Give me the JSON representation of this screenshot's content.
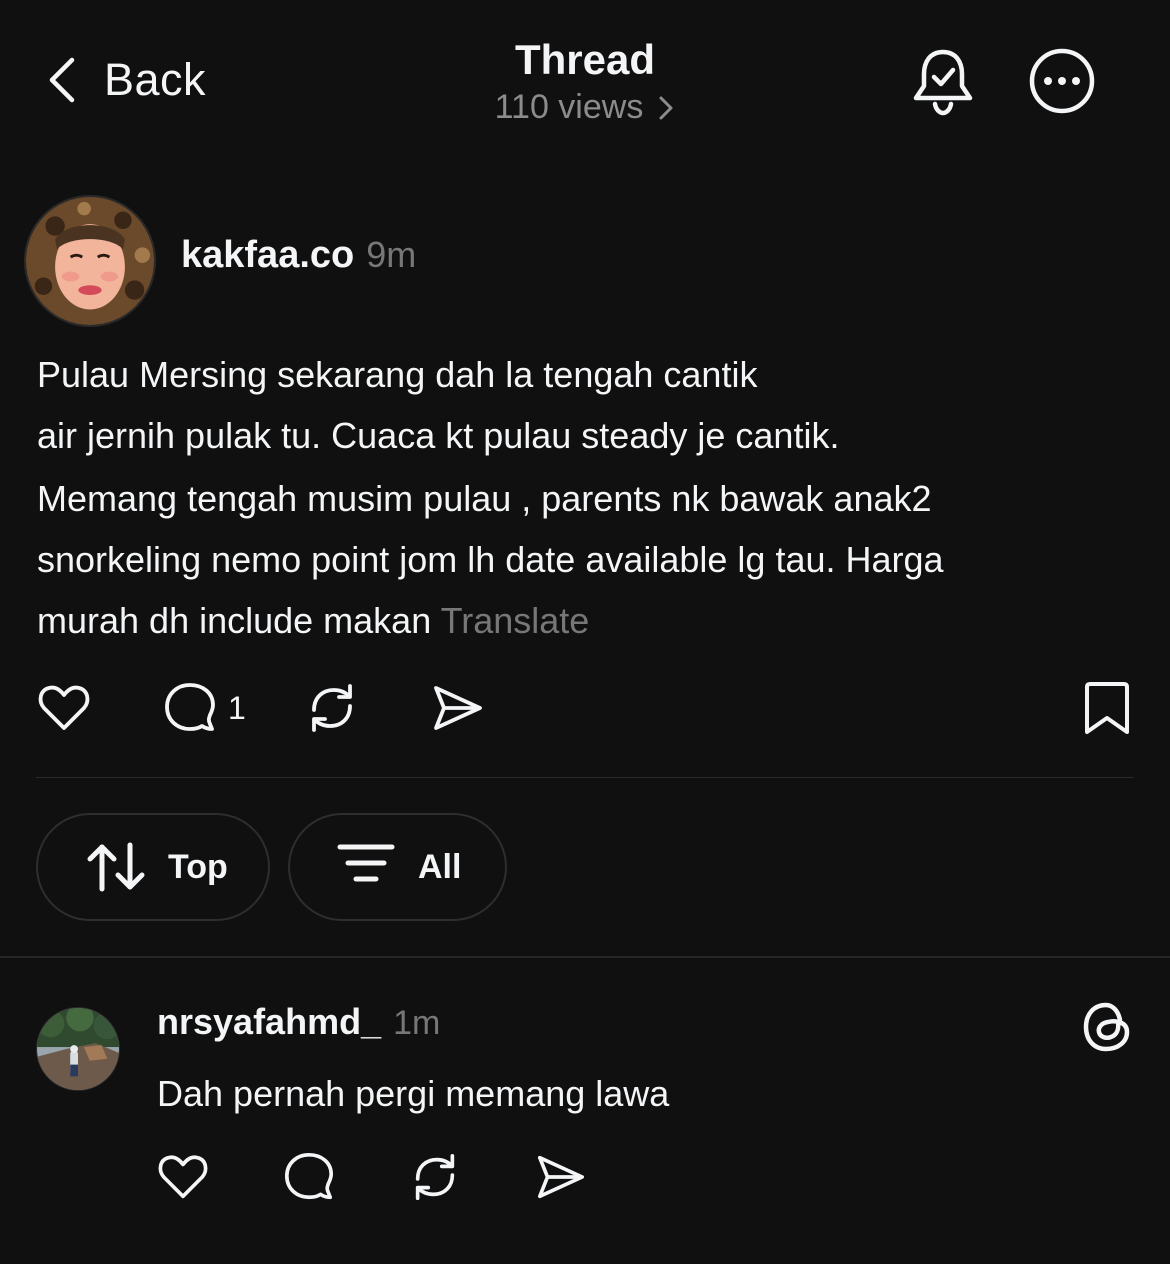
{
  "header": {
    "back_label": "Back",
    "title": "Thread",
    "views": "110 views"
  },
  "post": {
    "username": "kakfaa.co",
    "time": "9m",
    "lines": [
      "Pulau Mersing sekarang dah la tengah cantik",
      "air jernih pulak tu. Cuaca kt pulau steady je cantik.",
      "Memang tengah musim pulau , parents nk bawak anak2",
      "snorkeling nemo point jom lh date available lg tau. Harga",
      "murah dh include makan "
    ],
    "translate": "Translate",
    "reply_count": "1"
  },
  "filters": {
    "sort_label": "Top",
    "filter_label": "All"
  },
  "reply": {
    "username": "nrsyafahmd_",
    "time": "1m",
    "text": "Dah pernah pergi memang lawa"
  },
  "colors": {
    "background": "#101010",
    "text": "#f3f5f7",
    "secondary_text": "#777777",
    "border": "#2e2e2e"
  },
  "icons": [
    "chevron-left-icon",
    "chevron-right-icon",
    "bell-check-icon",
    "more-icon",
    "heart-icon",
    "comment-icon",
    "repost-icon",
    "share-icon",
    "bookmark-icon",
    "sort-arrows-icon",
    "filter-icon",
    "threads-logo-icon"
  ]
}
